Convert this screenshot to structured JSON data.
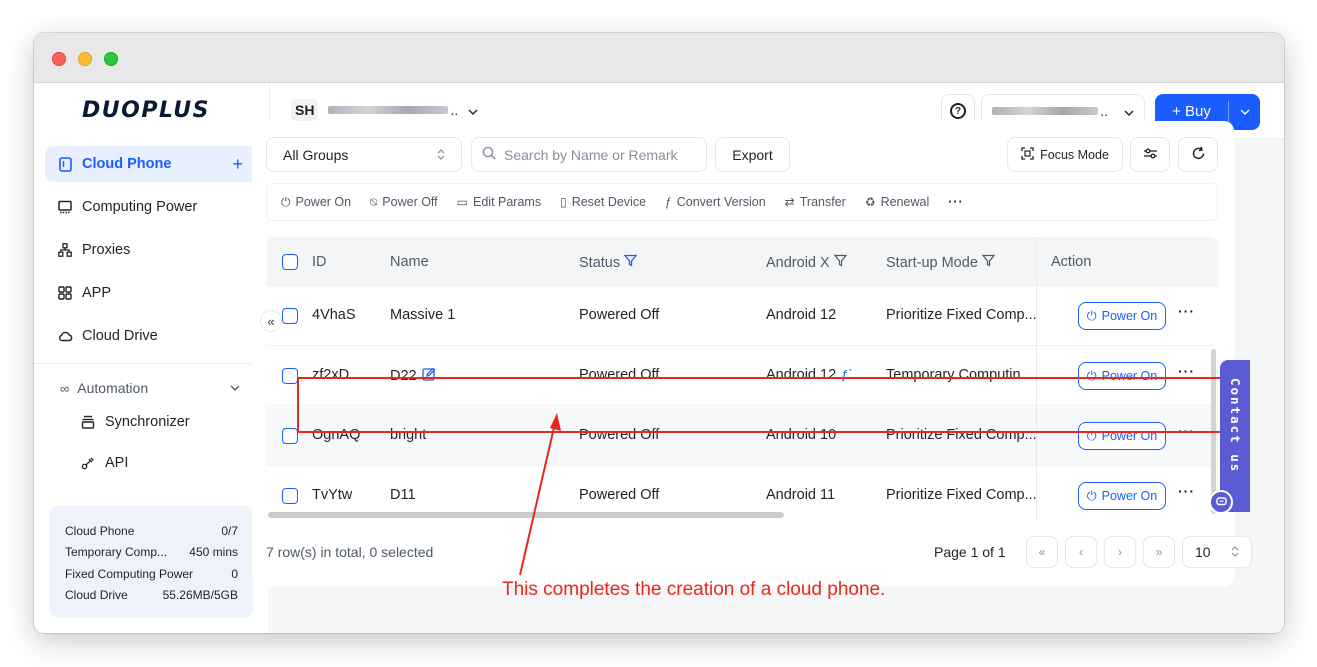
{
  "app": {
    "logo": "DUOPLUS"
  },
  "sidebar": {
    "items": [
      {
        "label": "Cloud Phone",
        "icon": "phone-icon"
      },
      {
        "label": "Computing Power",
        "icon": "monitor-icon"
      },
      {
        "label": "Proxies",
        "icon": "network-icon"
      },
      {
        "label": "APP",
        "icon": "apps-grid-icon"
      },
      {
        "label": "Cloud Drive",
        "icon": "cloud-icon"
      }
    ],
    "automation": {
      "label": "Automation",
      "items": [
        {
          "label": "Synchronizer",
          "icon": "synchronizer-icon"
        },
        {
          "label": "API",
          "icon": "api-icon"
        }
      ]
    },
    "collapse_glyph": "«",
    "quota": [
      {
        "label": "Cloud Phone",
        "value": "0/7"
      },
      {
        "label": "Temporary Comp...",
        "value": "450 mins"
      },
      {
        "label": "Fixed Computing Power",
        "value": "0"
      },
      {
        "label": "Cloud Drive",
        "value": "55.26MB/5GB"
      }
    ]
  },
  "header": {
    "team_badge": "SH",
    "team_suffix": "..",
    "account_suffix": "..",
    "buy_label": "+ Buy"
  },
  "filters": {
    "group_value": "All Groups",
    "search_placeholder": "Search by Name or Remark",
    "export_label": "Export",
    "focus_mode_label": "Focus Mode"
  },
  "toolbar": [
    {
      "label": "Power On",
      "icon": "power-icon"
    },
    {
      "label": "Power Off",
      "icon": "power-off-icon"
    },
    {
      "label": "Edit Params",
      "icon": "edit-params-icon"
    },
    {
      "label": "Reset Device",
      "icon": "reset-icon"
    },
    {
      "label": "Convert Version",
      "icon": "convert-icon"
    },
    {
      "label": "Transfer",
      "icon": "transfer-icon"
    },
    {
      "label": "Renewal",
      "icon": "renewal-icon"
    }
  ],
  "table": {
    "columns": [
      "ID",
      "Name",
      "Status",
      "Android X",
      "Start-up Mode",
      "Action"
    ],
    "rows": [
      {
        "id": "4VhaS",
        "name": "Massive 1",
        "status": "Powered Off",
        "android": "Android 12",
        "mode": "Prioritize Fixed Comp...",
        "action": "Power On"
      },
      {
        "id": "zf2xD",
        "name": "D22",
        "status": "Powered Off",
        "android": "Android 12",
        "mode": "Temporary Computin...",
        "action": "Power On"
      },
      {
        "id": "OgnAQ",
        "name": "bright",
        "status": "Powered Off",
        "android": "Android 10",
        "mode": "Prioritize Fixed Comp...",
        "action": "Power On"
      },
      {
        "id": "TvYtw",
        "name": "D11",
        "status": "Powered Off",
        "android": "Android 11",
        "mode": "Prioritize Fixed Comp...",
        "action": "Power On"
      }
    ]
  },
  "footer": {
    "summary": "7 row(s) in total, 0 selected",
    "page_label": "Page 1 of 1",
    "page_size": "10"
  },
  "contact_label": "Contact us",
  "annotation": "This completes the creation of a cloud phone.",
  "colors": {
    "accent": "#1a5cff",
    "annotation": "#e8281f",
    "contact": "#5b5bd6"
  }
}
